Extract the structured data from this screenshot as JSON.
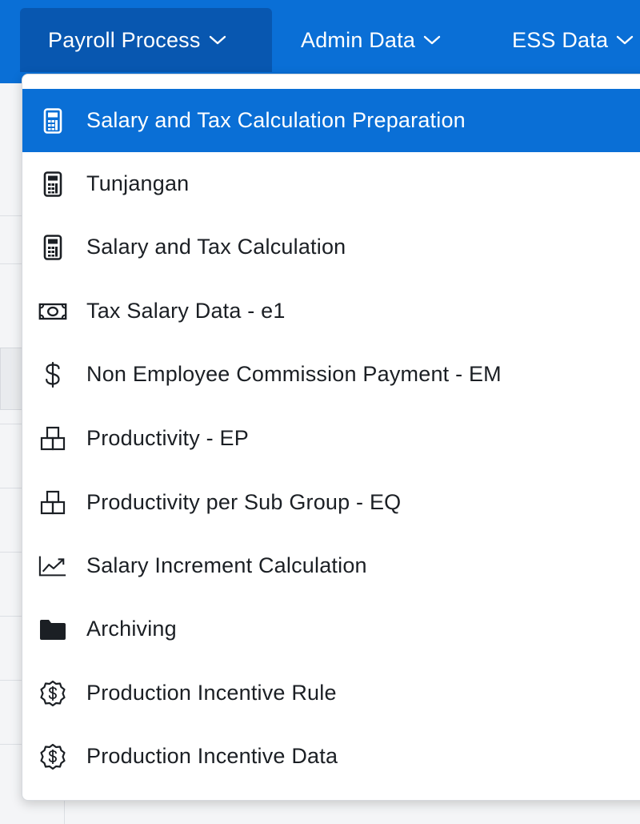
{
  "nav": {
    "tabs": [
      {
        "label": "Payroll Process",
        "active": true
      },
      {
        "label": "Admin Data",
        "active": false
      },
      {
        "label": "ESS Data",
        "active": false
      }
    ]
  },
  "menu": {
    "items": [
      {
        "label": "Salary and Tax Calculation Preparation",
        "icon": "calculator-icon",
        "selected": true
      },
      {
        "label": "Tunjangan",
        "icon": "calculator-icon"
      },
      {
        "label": "Salary and Tax Calculation",
        "icon": "calculator-icon"
      },
      {
        "label": "Tax Salary Data - e1",
        "icon": "money-bill-icon"
      },
      {
        "label": "Non Employee Commission Payment - EM",
        "icon": "dollar-sign-icon"
      },
      {
        "label": "Productivity - EP",
        "icon": "boxes-icon"
      },
      {
        "label": "Productivity per Sub Group - EQ",
        "icon": "boxes-icon"
      },
      {
        "label": "Salary Increment Calculation",
        "icon": "trend-chart-icon"
      },
      {
        "label": "Archiving",
        "icon": "folder-icon"
      },
      {
        "label": "Production Incentive Rule",
        "icon": "dollar-badge-icon"
      },
      {
        "label": "Production Incentive Data",
        "icon": "dollar-badge-icon"
      }
    ]
  },
  "colors": {
    "accent": "#0a6fd6",
    "accent_dark": "#0857b0",
    "text": "#1b1f24"
  }
}
